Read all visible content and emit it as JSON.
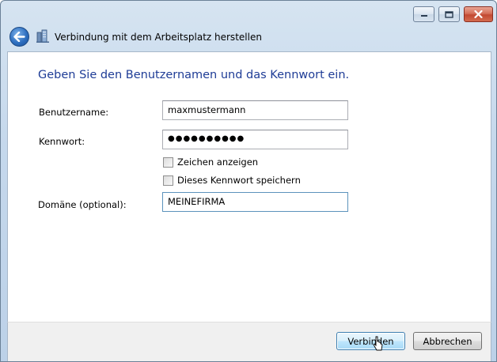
{
  "window": {
    "title": "Verbindung mit dem Arbeitsplatz herstellen"
  },
  "heading": "Geben Sie den Benutzernamen und das Kennwort ein.",
  "form": {
    "username_label": "Benutzername:",
    "username_value": "maxmustermann",
    "password_label": "Kennwort:",
    "password_value": "●●●●●●●●●●",
    "show_chars_label": "Zeichen anzeigen",
    "show_chars_checked": false,
    "save_password_label": "Dieses Kennwort speichern",
    "save_password_checked": false,
    "domain_label": "Domäne (optional):",
    "domain_value": "MEINEFIRMA"
  },
  "buttons": {
    "connect": "Verbinden",
    "cancel": "Abbrechen"
  },
  "icons": {
    "back": "back-arrow-icon",
    "app": "workplace-network-icon",
    "minimize": "minimize-icon",
    "maximize": "maximize-icon",
    "close": "close-icon"
  },
  "colors": {
    "heading": "#1e3c96",
    "close_button": "#c24a32",
    "default_button_border": "#3c7fb1"
  }
}
